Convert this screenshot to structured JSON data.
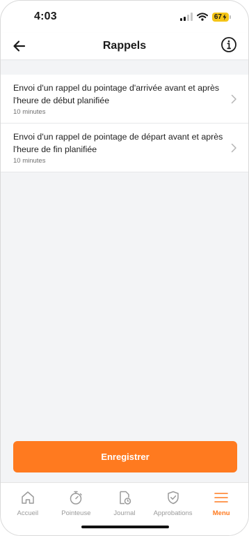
{
  "status_bar": {
    "time": "4:03",
    "battery": "67"
  },
  "header": {
    "title": "Rappels",
    "back_icon": "arrow-left-icon",
    "info_icon": "info-circle-icon"
  },
  "reminders": [
    {
      "title": "Envoi d'un rappel du pointage d'arrivée avant et après l'heure de début planifiée",
      "value": "10 minutes"
    },
    {
      "title": "Envoi d'un rappel de pointage de départ avant et après l'heure de fin planifiée",
      "value": "10 minutes"
    }
  ],
  "save_label": "Enregistrer",
  "nav": {
    "items": [
      {
        "label": "Accueil",
        "icon": "home-icon"
      },
      {
        "label": "Pointeuse",
        "icon": "stopwatch-icon"
      },
      {
        "label": "Journal",
        "icon": "journal-icon"
      },
      {
        "label": "Approbations",
        "icon": "shield-check-icon"
      },
      {
        "label": "Menu",
        "icon": "menu-icon"
      }
    ],
    "active": "Menu"
  },
  "colors": {
    "accent": "#ff7a1f",
    "background": "#f3f4f6",
    "battery": "#f5c518"
  }
}
